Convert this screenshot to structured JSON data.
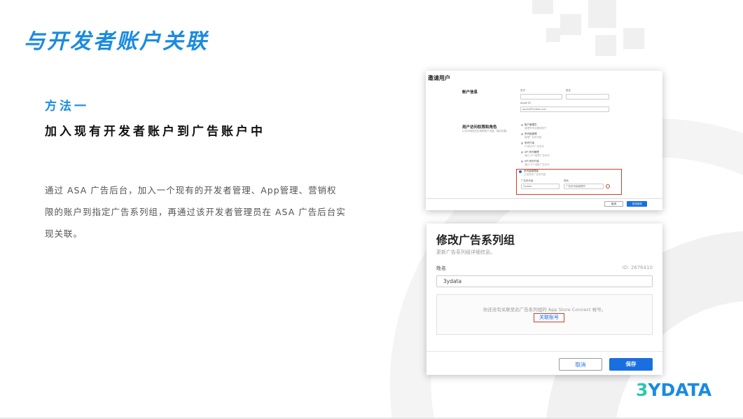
{
  "slide": {
    "title": "与开发者账户关联",
    "method_label": "方法一",
    "method_heading": "加入现有开发者账户到广告账户中",
    "description": "通过 ASA 广告后台，加入一个现有的开发者管理、App管理、营销权限的账户到指定广告系列组，再通过该开发者管理员在 ASA 广告后台实现关联。"
  },
  "invite_screen": {
    "title": "邀请用户",
    "account_section": "帐户信息",
    "first_name_label": "名字",
    "last_name_label": "姓氏",
    "apple_id_label": "Apple ID",
    "apple_id_value": "apple@3ydata.com",
    "roles_section": "用户访问权限和角色",
    "roles_sub": "以访问相应的应用和帐户功能。建议设置。",
    "roles": [
      {
        "name": "账户管理员",
        "desc": "管理所有设置和账户"
      },
      {
        "name": "系列组管理",
        "desc": "管理广告系列组"
      },
      {
        "name": "系列只读",
        "desc": "只读访问广告系列"
      },
      {
        "name": "API 系列管理",
        "desc": "通过 API 管理广告系列"
      },
      {
        "name": "API 系列只读",
        "desc": "通过 API 读取广告系列"
      }
    ],
    "selected_role": "系列组管理者",
    "selected_role_desc": "已选择的广告系列组",
    "group_label": "广告系列组",
    "group_value": "3ydata",
    "role_label": "角色",
    "role_value": "广告系列组管理员",
    "cancel_button": "取消",
    "send_button": "发送邀请"
  },
  "edit_screen": {
    "title": "修改广告系列组",
    "subtitle": "更新广告系列组详细信息。",
    "name_label": "姓名",
    "id_label": "ID: 2676410",
    "name_value": "3ydata",
    "assoc_text": "你还没有关联至此广告系列组的 App Store Connect 帐号。",
    "assoc_link": "关联账号",
    "cancel_button": "取消",
    "save_button": "保存"
  },
  "logo": {
    "part1": "3",
    "part2": "YDATA"
  },
  "colors": {
    "accent": "#1a8be0",
    "highlight": "#d0402a",
    "logo_green": "#2bc7b2",
    "button_blue": "#1a6fe0"
  }
}
